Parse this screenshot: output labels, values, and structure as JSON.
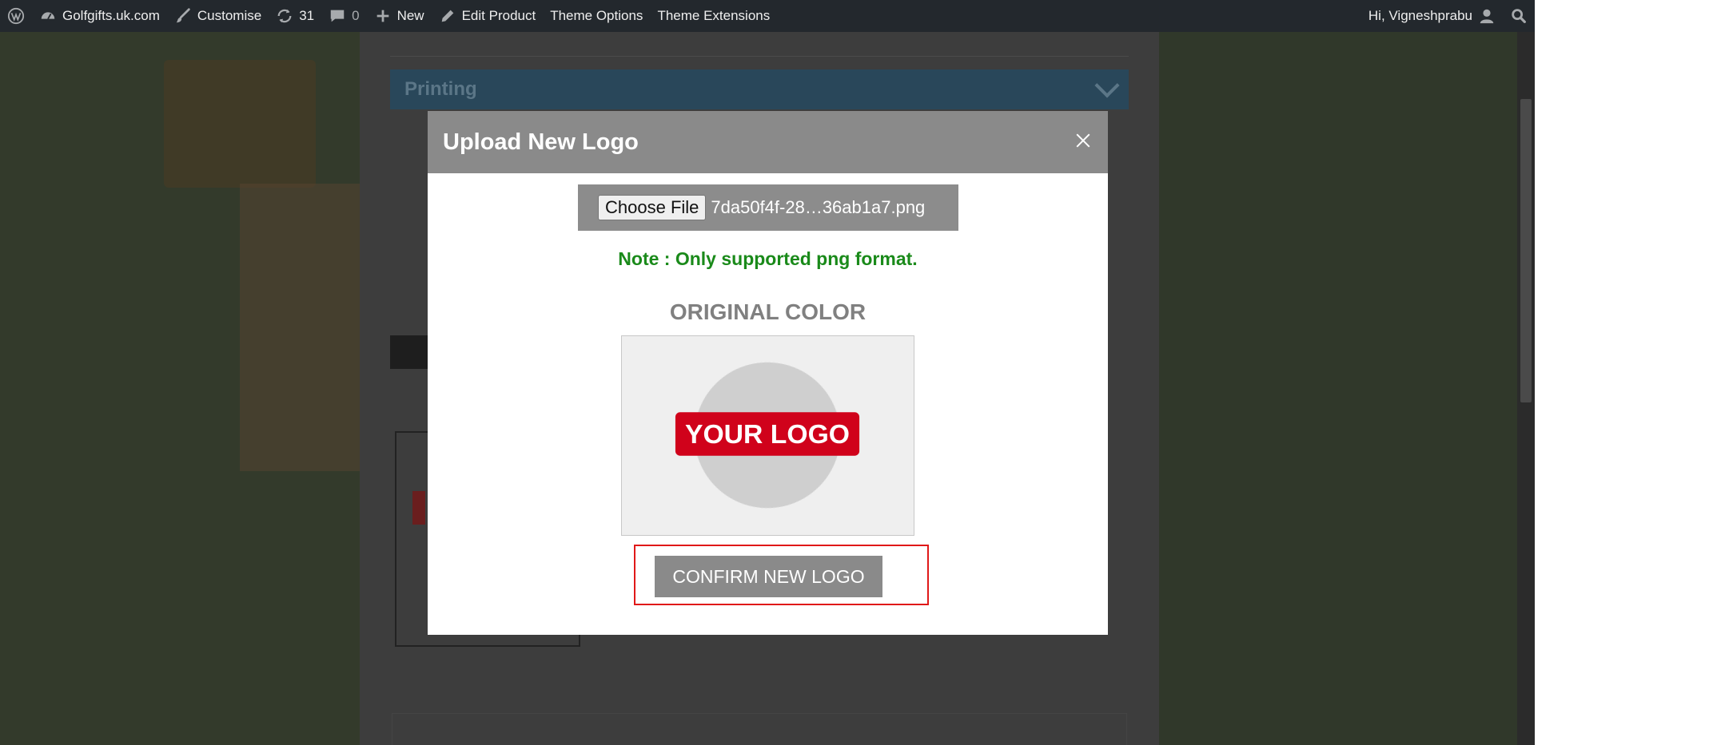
{
  "adminbar": {
    "site_name": "Golfgifts.uk.com",
    "customise": "Customise",
    "updates_count": "31",
    "comments_count": "0",
    "new_label": "New",
    "edit_product": "Edit Product",
    "theme_options": "Theme Options",
    "theme_extensions": "Theme Extensions",
    "greeting": "Hi, Vigneshprabu"
  },
  "background": {
    "section_title": "Printing"
  },
  "modal": {
    "title": "Upload New Logo",
    "choose_file_label": "Choose File",
    "file_name": "7da50f4f-28…36ab1a7.png",
    "note": "Note : Only supported png format.",
    "color_heading": "ORIGINAL COLOR",
    "logo_text": "YOUR LOGO",
    "confirm_label": "CONFIRM NEW LOGO"
  },
  "colors": {
    "adminbar_bg": "#23282d",
    "modal_header": "#8a8a8a",
    "note_green": "#1a8a1a",
    "logo_red": "#d0021b",
    "highlight_red": "#e01818"
  }
}
